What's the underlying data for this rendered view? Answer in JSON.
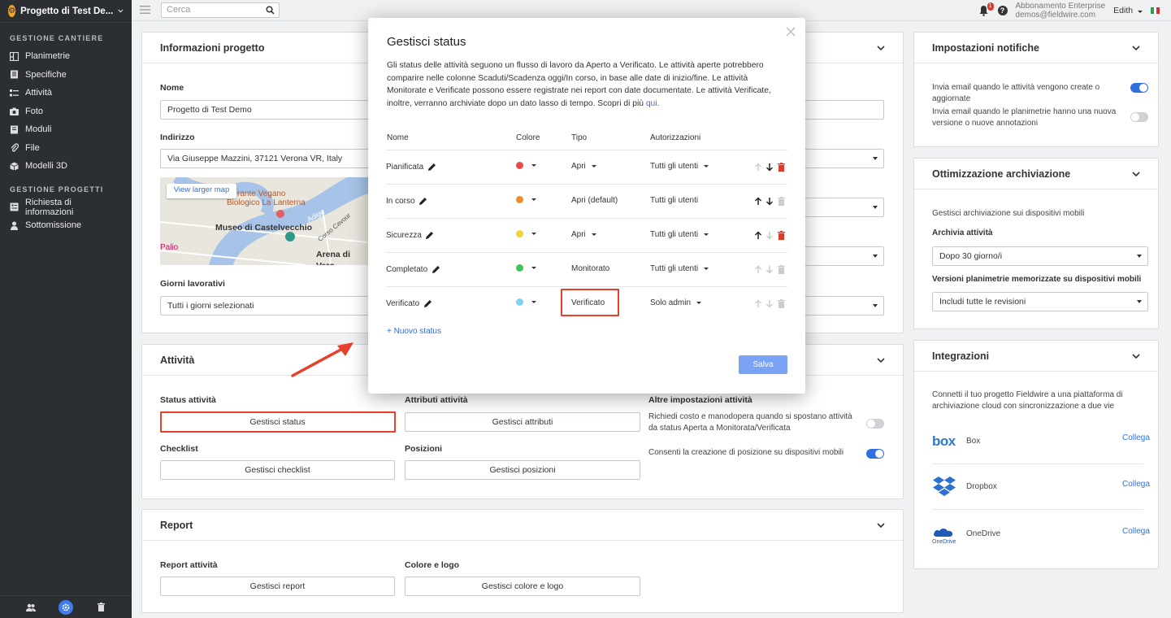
{
  "sidebar": {
    "project_name": "Progetto di Test De...",
    "section_site": "GESTIONE CANTIERE",
    "site_items": [
      {
        "label": "Planimetrie",
        "icon": "map-icon"
      },
      {
        "label": "Specifiche",
        "icon": "book-icon"
      },
      {
        "label": "Attività",
        "icon": "tasks-icon"
      },
      {
        "label": "Foto",
        "icon": "camera-icon"
      },
      {
        "label": "Moduli",
        "icon": "forms-icon"
      },
      {
        "label": "File",
        "icon": "paperclip-icon"
      },
      {
        "label": "Modelli 3D",
        "icon": "cube-icon"
      }
    ],
    "section_projects": "GESTIONE PROGETTI",
    "project_items": [
      {
        "label": "Richiesta di informazioni",
        "icon": "rfi-icon"
      },
      {
        "label": "Sottomissione",
        "icon": "person-icon"
      }
    ]
  },
  "topbar": {
    "search_placeholder": "Cerca",
    "notification_count": "1",
    "account_plan": "Abbonamento Enterprise",
    "account_email": "demos@fieldwire.com",
    "user_name": "Edith"
  },
  "project_info": {
    "title": "Informazioni progetto",
    "name_label": "Nome",
    "name_value": "Progetto di Test Demo",
    "address_label": "Indirizzo",
    "address_value": "Via Giuseppe Mazzini, 37121 Verona VR, Italy",
    "map_button": "View larger map",
    "map_labels": [
      "rante Vegano",
      "Biologico La Lanterna",
      "Museo di Castelvecchio",
      "Adige",
      "Corso Cavour",
      "Palio",
      "Arena di Vero"
    ],
    "workdays_label": "Giorni lavorativi",
    "workdays_value": "Tutti i giorni selezionati"
  },
  "tasks_card": {
    "title": "Attività",
    "status_label": "Status attività",
    "status_button": "Gestisci status",
    "attributes_label": "Attributi attività",
    "attributes_button": "Gestisci attributi",
    "other_label": "Altre impostazioni attività",
    "other_1": "Richiedi costo e manodopera quando si spostano attività da status Aperta a Monitorata/Verificata",
    "other_2": "Consenti la creazione di posizione su dispositivi mobili",
    "checklist_label": "Checklist",
    "checklist_button": "Gestisci checklist",
    "positions_label": "Posizioni",
    "positions_button": "Gestisci posizioni"
  },
  "report_card": {
    "title": "Report",
    "report_label": "Report attività",
    "report_button": "Gestisci report",
    "color_label": "Colore e logo",
    "color_button": "Gestisci colore e logo"
  },
  "notifications": {
    "title": "Impostazioni notifiche",
    "item_1": "Invia email quando le attività vengono create o aggiornate",
    "item_2": "Invia email quando le planimetrie hanno una nuova versione o nuove annotazioni"
  },
  "storage": {
    "title": "Ottimizzazione archiviazione",
    "desc": "Gestisci archiviazione sui dispositivi mobili",
    "archive_label": "Archivia attività",
    "archive_value": "Dopo 30 giorno/i",
    "versions_label": "Versioni planimetrie memorizzate su dispositivi mobili",
    "versions_value": "Includi tutte le revisioni"
  },
  "integrations": {
    "title": "Integrazioni",
    "desc": "Connetti il tuo progetto Fieldwire a una piattaforma di archiviazione cloud con sincronizzazione a due vie",
    "items": [
      {
        "name": "Box",
        "logo": "box",
        "action": "Collega"
      },
      {
        "name": "Dropbox",
        "logo": "dropbox",
        "action": "Collega"
      },
      {
        "name": "OneDrive",
        "logo": "OneDrive",
        "action": "Collega"
      }
    ]
  },
  "modal": {
    "title": "Gestisci status",
    "description": "Gli status delle attività seguono un flusso di lavoro da Aperto a Verificato. Le attività aperte potrebbero comparire nelle colonne Scaduti/Scadenza oggi/In corso, in base alle date di inizio/fine. Le attività Monitorate e Verificate possono essere registrate nei report con date documentate. Le attività Verificate, inoltre, verranno archiviate dopo un dato lasso di tempo. Scopri di più ",
    "learn_more": "qui",
    "columns": [
      "Nome",
      "Colore",
      "Tipo",
      "Autorizzazioni"
    ],
    "rows": [
      {
        "name": "Pianificata",
        "color": "#e84a4a",
        "type": "Apri",
        "type_dropdown": true,
        "perm": "Tutti gli utenti",
        "perm_dropdown": true,
        "up": false,
        "down": true,
        "delete": true
      },
      {
        "name": "In corso",
        "color": "#ef8c2e",
        "type": "Apri (default)",
        "type_dropdown": false,
        "perm": "Tutti gli utenti",
        "perm_dropdown": false,
        "up": true,
        "down": true,
        "delete": false
      },
      {
        "name": "Sicurezza",
        "color": "#f2d33a",
        "type": "Apri",
        "type_dropdown": true,
        "perm": "Tutti gli utenti",
        "perm_dropdown": true,
        "up": true,
        "down": false,
        "delete": true
      },
      {
        "name": "Completato",
        "color": "#3fc45a",
        "type": "Monitorato",
        "type_dropdown": false,
        "perm": "Tutti gli utenti",
        "perm_dropdown": true,
        "up": false,
        "down": false,
        "delete": false
      },
      {
        "name": "Verificato",
        "color": "#7fd0f2",
        "type": "Verificato",
        "type_dropdown": false,
        "perm": "Solo admin",
        "perm_dropdown": true,
        "up": false,
        "down": false,
        "delete": false
      }
    ],
    "new_status": "+ Nuovo status",
    "save": "Salva"
  },
  "colors": {
    "accent": "#2f6fe0",
    "highlight": "#e8402a",
    "sidebar_bg": "#2b2e33"
  }
}
